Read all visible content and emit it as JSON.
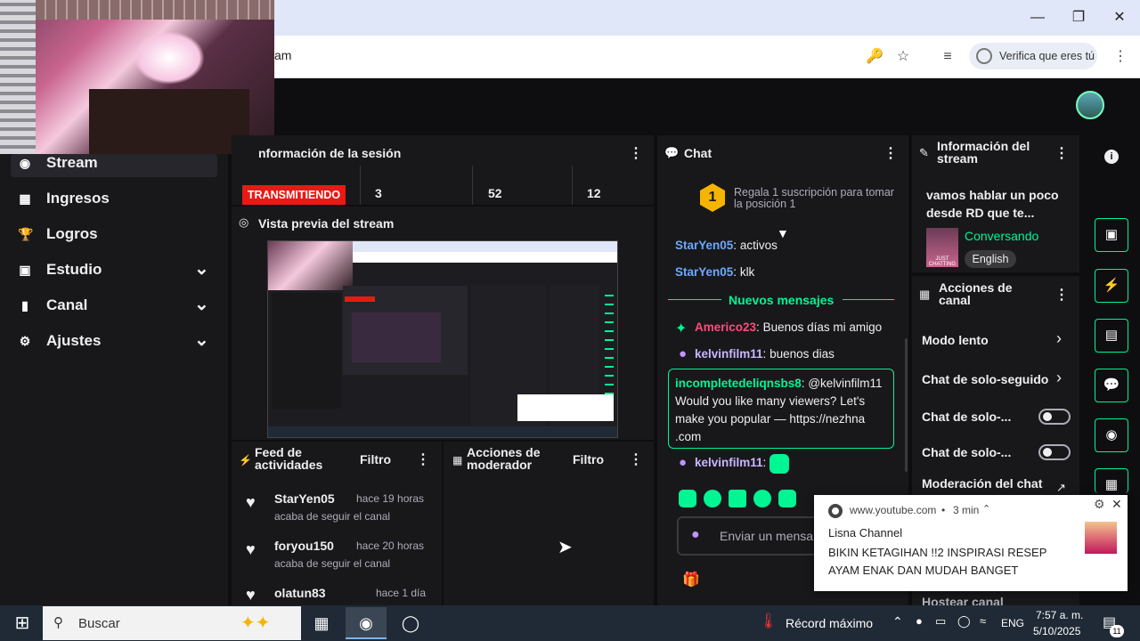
{
  "browser": {
    "url_fragment": "am",
    "verify_label": "Verifica que eres tú",
    "window_controls": [
      "minimize",
      "maximize",
      "close"
    ]
  },
  "sidebar": {
    "items": [
      {
        "label": "Stream",
        "icon": "stream-icon",
        "expandable": false
      },
      {
        "label": "Ingresos",
        "icon": "income-icon",
        "expandable": false
      },
      {
        "label": "Logros",
        "icon": "trophy-icon",
        "expandable": false
      },
      {
        "label": "Estudio",
        "icon": "studio-icon",
        "expandable": true
      },
      {
        "label": "Canal",
        "icon": "channel-icon",
        "expandable": true
      },
      {
        "label": "Ajustes",
        "icon": "gear-icon",
        "expandable": true
      }
    ]
  },
  "session": {
    "title": "Información de la sesión",
    "title_visible": "nformación de la sesión",
    "status": "TRANSMITIENDO",
    "stats": [
      "3",
      "52",
      "12"
    ]
  },
  "preview": {
    "title": "Vista previa del stream"
  },
  "feed": {
    "title": "Feed de actividades",
    "filter": "Filtro",
    "items": [
      {
        "name": "StarYen05",
        "time": "hace 19 horas",
        "action": "acaba de seguir el canal"
      },
      {
        "name": "foryou150",
        "time": "hace 20 horas",
        "action": "acaba de seguir el canal"
      },
      {
        "name": "olatun83",
        "time": "hace 1 día",
        "action": ""
      }
    ]
  },
  "moderator": {
    "title": "Acciones de moderador",
    "filter": "Filtro"
  },
  "chat": {
    "title": "Chat",
    "gift_text": "Regala 1 suscripción para tomar la posición 1",
    "gift_rank": "1",
    "messages_old": [
      {
        "user": "StarYen05",
        "text": "activos"
      },
      {
        "user": "StarYen05",
        "text": "klk"
      }
    ],
    "new_divider": "Nuevos mensajes",
    "messages_new": [
      {
        "user": "Americo23",
        "text": "Buenos días mi amigo",
        "color": "#ff4b7b"
      },
      {
        "user": "kelvinfilm11",
        "text": "buenos dias",
        "color": "#c9b6ff"
      }
    ],
    "highlighted": {
      "user": "incompletedeliqnsbs8",
      "mention": "@kelvinfilm11",
      "text": "Would you like many viewers? Let's make you popular — https://nezhna .com"
    },
    "last": {
      "user": "kelvinfilm11",
      "text": ""
    },
    "input_placeholder": "Enviar un mensa"
  },
  "stream_info": {
    "title": "Información del stream",
    "stream_title": "vamos hablar un poco desde RD que te...",
    "category": "Conversando",
    "category_thumb": "JUST CHATTING",
    "language": "English"
  },
  "channel_actions": {
    "title": "Acciones de canal",
    "items": [
      {
        "label": "Modo lento",
        "control": "chevron"
      },
      {
        "label": "Chat de solo-seguido",
        "control": "chevron"
      },
      {
        "label": "Chat de solo-...",
        "control": "toggle"
      },
      {
        "label": "Chat de solo-...",
        "control": "toggle"
      },
      {
        "label": "Moderación del chat",
        "control": "popout"
      }
    ],
    "cut_item": "Hostear canal"
  },
  "notification": {
    "source": "www.youtube.com",
    "age": "3 min",
    "channel": "Lisna Channel",
    "text": "BIKIN KETAGIHAN !!2 INSPIRASI RESEP AYAM ENAK DAN MUDAH BANGET"
  },
  "taskbar": {
    "search_placeholder": "Buscar",
    "weather_text": "Récord máximo",
    "language": "ENG",
    "time": "7:57 a. m.",
    "date": "5/10/2025",
    "notifications_count": "11"
  },
  "colors": {
    "accent": "#00f593",
    "live": "#e91916",
    "twitch_bg": "#0e0e10",
    "panel": "#18181b",
    "link": "#6ba9ff"
  }
}
